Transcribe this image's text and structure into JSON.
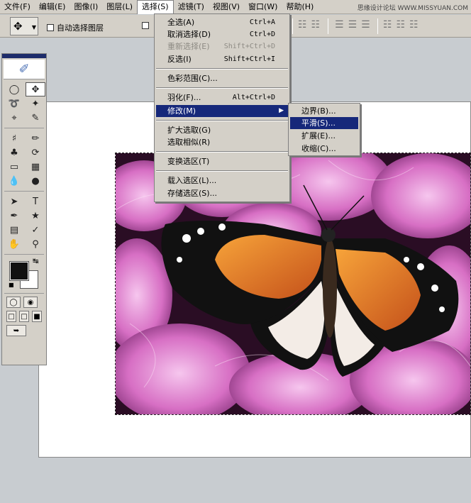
{
  "menubar": {
    "items": [
      "文件(F)",
      "编辑(E)",
      "图像(I)",
      "图层(L)",
      "选择(S)",
      "滤镜(T)",
      "视图(V)",
      "窗口(W)",
      "帮助(H)"
    ],
    "active": "选择(S)",
    "watermark": "思缘设计论坛 WWW.MISSYUAN.COM"
  },
  "options": {
    "auto_select_label": "自动选择图层",
    "auto_select_checked": false
  },
  "select_menu": {
    "items": [
      {
        "label": "全选(A)",
        "shortcut": "Ctrl+A"
      },
      {
        "label": "取消选择(D)",
        "shortcut": "Ctrl+D"
      },
      {
        "label": "重新选择(E)",
        "shortcut": "Shift+Ctrl+D",
        "disabled": true
      },
      {
        "label": "反选(I)",
        "shortcut": "Shift+Ctrl+I"
      },
      {
        "label": "色彩范围(C)..."
      },
      {
        "label": "羽化(F)...",
        "shortcut": "Alt+Ctrl+D"
      },
      {
        "label": "修改(M)",
        "submenu": true,
        "highlighted": true
      },
      {
        "label": "扩大选取(G)"
      },
      {
        "label": "选取相似(R)"
      },
      {
        "label": "变换选区(T)"
      },
      {
        "label": "载入选区(L)..."
      },
      {
        "label": "存储选区(S)..."
      }
    ]
  },
  "modify_submenu": {
    "items": [
      {
        "label": "边界(B)..."
      },
      {
        "label": "平滑(S)...",
        "highlighted": true
      },
      {
        "label": "扩展(E)..."
      },
      {
        "label": "收缩(C)..."
      }
    ]
  },
  "colors": {
    "highlight": "#16287a",
    "foreground": "#111111",
    "background": "#ffffff"
  },
  "toolbox": {
    "tools": [
      "marquee-icon",
      "move-icon",
      "lasso-icon",
      "magic-wand-icon",
      "crop-icon",
      "slice-icon",
      "healing-brush-icon",
      "brush-icon",
      "clone-stamp-icon",
      "history-brush-icon",
      "eraser-icon",
      "gradient-icon",
      "blur-icon",
      "dodge-icon",
      "path-select-icon",
      "type-icon",
      "pen-icon",
      "shape-icon",
      "notes-icon",
      "eyedropper-icon",
      "hand-icon",
      "zoom-icon"
    ]
  }
}
